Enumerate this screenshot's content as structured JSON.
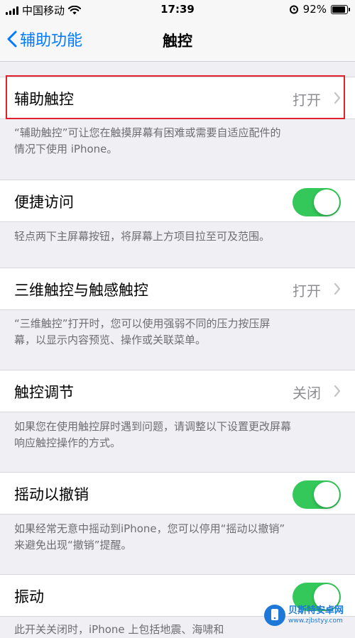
{
  "status": {
    "carrier": "中国移动",
    "time": "17:39",
    "battery": "92%"
  },
  "nav": {
    "back_label": "辅助功能",
    "title": "触控"
  },
  "rows": [
    {
      "label": "辅助触控",
      "value": "打开"
    },
    {
      "label": "便捷访问",
      "toggle": true
    },
    {
      "label": "三维触控与触感触控",
      "value": "打开"
    },
    {
      "label": "触控调节",
      "value": "关闭"
    },
    {
      "label": "摇动以撤销",
      "toggle": true
    },
    {
      "label": "振动",
      "toggle": true
    }
  ],
  "footers": [
    [
      "“辅助触控”可让您在触摸屏幕有困难或需要自适应配件的",
      "情况下使用 iPhone。"
    ],
    [
      "轻点两下主屏幕按钮，将屏幕上方项目拉至可及范围。"
    ],
    [
      "“三维触控”打开时，您可以使用强弱不同的压力按压屏",
      "幕，以显示内容预览、操作或关联菜单。"
    ],
    [
      "如果您在使用触控屏时遇到问题，请调整以下设置更改屏幕",
      "响应触控操作的方式。"
    ],
    [
      "如果经常无意中摇动到iPhone，您可以停用“摇动以撤销”",
      "来避免出现“撤销”提醒。"
    ],
    [
      "此开关关闭时，iPhone 上包括地震、海啸和"
    ]
  ],
  "watermark": {
    "name": "贝斯特安卓网",
    "url": "www.zjbstyy.com"
  },
  "colors": {
    "accent": "#007aff",
    "toggle_on": "#34c759",
    "highlight": "#e0202a"
  }
}
